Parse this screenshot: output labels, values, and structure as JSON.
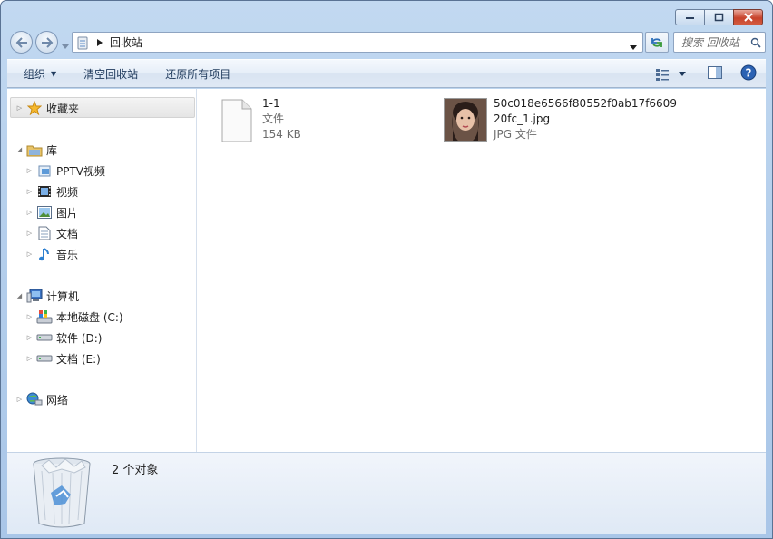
{
  "window": {
    "title": "回收站"
  },
  "address": {
    "path": "回收站"
  },
  "search": {
    "placeholder": "搜索 回收站"
  },
  "commandbar": {
    "organize": "组织",
    "empty_bin": "清空回收站",
    "restore_all": "还原所有项目"
  },
  "nav": {
    "favorites": "收藏夹",
    "libraries": "库",
    "lib_pptv": "PPTV视频",
    "lib_videos": "视频",
    "lib_pictures": "图片",
    "lib_docs": "文档",
    "lib_music": "音乐",
    "computer": "计算机",
    "drive_c": "本地磁盘 (C:)",
    "drive_d": "软件 (D:)",
    "drive_e": "文档 (E:)",
    "network": "网络"
  },
  "files": [
    {
      "name": "1-1",
      "type": "文件",
      "size": "154 KB"
    },
    {
      "name_line1": "50c018e6566f80552f0ab17f6609",
      "name_line2": "20fc_1.jpg",
      "type": "JPG 文件"
    }
  ],
  "details": {
    "count": "2 个对象"
  },
  "colors": {
    "frame": "#b5cfec",
    "close_button": "#c8432b",
    "command_text": "#1e395b"
  }
}
